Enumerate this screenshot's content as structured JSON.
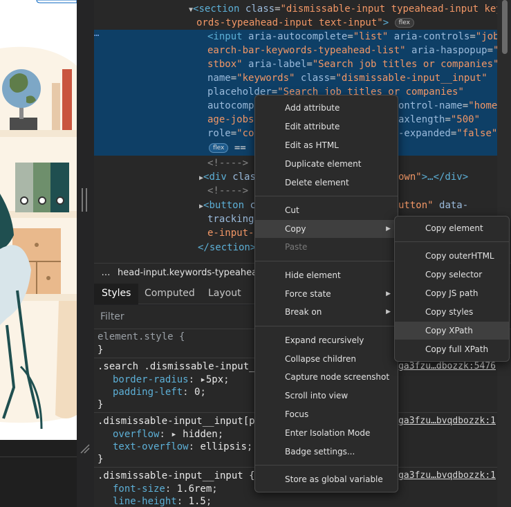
{
  "elements_panel": {
    "lines": {
      "section_open": {
        "tag": "<section",
        "attr1": "class",
        "val1": "\"dismissable-input typeahead-input keyw",
        "cont": "ords-typeahead-input text-input\"",
        "close": ">",
        "badge": "flex"
      },
      "input_1": {
        "tag": "<input",
        "attr": "aria-autocomplete",
        "val": "\"list\"",
        "attr2": "aria-controls",
        "val2": "\"job-s"
      },
      "input_2": {
        "val": "earch-bar-keywords-typeahead-list\"",
        "attr": "aria-haspopup",
        "val2": "\"li"
      },
      "input_3": {
        "val": "stbox\"",
        "attr": "aria-label",
        "val2": "\"Search job titles or companies\""
      },
      "input_4": {
        "attr": "name",
        "val": "\"keywords\"",
        "attr2": "class",
        "val2": "\"dismissable-input__input\""
      },
      "input_5": {
        "attr": "placeholder",
        "val": "\"Search job titles or companies\""
      },
      "input_6": {
        "attr": "autocomp",
        "mid": "ontrol-name",
        "val": "\"homep"
      },
      "input_7": {
        "val": "age-jobse",
        "attr": "axlength",
        "val2": "\"500\""
      },
      "input_8": {
        "attr": "role",
        "val": "\"com",
        "attr2": "-expanded",
        "val2": "\"false\"",
        "close": ">"
      },
      "input_9": {
        "badge": "flex",
        "rest": "=="
      },
      "comment_1": "<!---->",
      "div_line": {
        "tag": "<div",
        "attr": "clas",
        "val": "own\"",
        "rest": ">…</div>"
      },
      "comment_2": "<!---->",
      "button_1": {
        "tag": "<button",
        "attr": "c",
        "val": "utton\"",
        "attr2": "data-"
      },
      "button_2": {
        "attr": "tracking-"
      },
      "button_3": {
        "val": "e-input-c"
      },
      "section_close": "</section>"
    },
    "more_dots": "⋯"
  },
  "breadcrumb": {
    "more": "…",
    "text": "head-input.keywords-typeahea"
  },
  "tabs": {
    "styles": "Styles",
    "computed": "Computed",
    "layout": "Layout"
  },
  "filter": {
    "placeholder": "Filter"
  },
  "styles": {
    "element_style": {
      "selector": "element.style {",
      "close": "}"
    },
    "rule1": {
      "selector": ".search .dismissable-input__",
      "p1": "border-radius",
      "v1": "5px",
      "p2": "padding-left",
      "v2": "0",
      "close": "}",
      "src": "ga3fzu…dbozzk:5476"
    },
    "rule2": {
      "selector": ".dismissable-input__input[pl",
      "p1": "overflow",
      "v1": "hidden",
      "p2": "text-overflow",
      "v2": "ellipsis",
      "close": "}",
      "src": "ga3fzu…bvqdbozzk:1"
    },
    "rule3": {
      "selector": ".dismissable-input__input {",
      "p1": "font-size",
      "v1": "1.6rem",
      "p2": "line-height",
      "v2": "1.5",
      "src": "ga3fzu…bvqdbozzk:1"
    }
  },
  "context_menu": {
    "items": [
      {
        "label": "Add attribute"
      },
      {
        "label": "Edit attribute"
      },
      {
        "label": "Edit as HTML"
      },
      {
        "label": "Duplicate element"
      },
      {
        "label": "Delete element"
      },
      {
        "label": "Cut"
      },
      {
        "label": "Copy"
      },
      {
        "label": "Paste"
      },
      {
        "label": "Hide element"
      },
      {
        "label": "Force state"
      },
      {
        "label": "Break on"
      },
      {
        "label": "Expand recursively"
      },
      {
        "label": "Collapse children"
      },
      {
        "label": "Capture node screenshot"
      },
      {
        "label": "Scroll into view"
      },
      {
        "label": "Focus"
      },
      {
        "label": "Enter Isolation Mode"
      },
      {
        "label": "Badge settings..."
      },
      {
        "label": "Store as global variable"
      }
    ]
  },
  "copy_submenu": {
    "items": [
      {
        "label": "Copy element"
      },
      {
        "label": "Copy outerHTML"
      },
      {
        "label": "Copy selector"
      },
      {
        "label": "Copy JS path"
      },
      {
        "label": "Copy styles"
      },
      {
        "label": "Copy XPath"
      },
      {
        "label": "Copy full XPath"
      }
    ],
    "highlighted": "Copy XPath"
  },
  "colors": {
    "selection": "#0e3f66",
    "tag": "#5db0d7",
    "attr_value": "#f29766",
    "menu_bg": "#2b2b2b"
  }
}
